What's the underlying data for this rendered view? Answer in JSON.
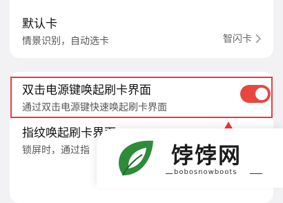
{
  "top_item": {
    "title": "默认卡",
    "subtitle": "情景识别，自动选卡",
    "value": "智闪卡"
  },
  "toggle_item": {
    "title": "双击电源键唤起刷卡界面",
    "subtitle": "通过双击电源键快速唤起刷卡界面",
    "enabled": true
  },
  "fingerprint_item": {
    "title": "指纹唤起刷卡界面",
    "subtitle": "锁屏时，通过指"
  },
  "watermark": {
    "brand": "饽饽网",
    "url": "bobosnowboots"
  },
  "colors": {
    "accent": "#e8473f",
    "highlight": "#e8383d",
    "logo_green": "#2e8b3a"
  }
}
